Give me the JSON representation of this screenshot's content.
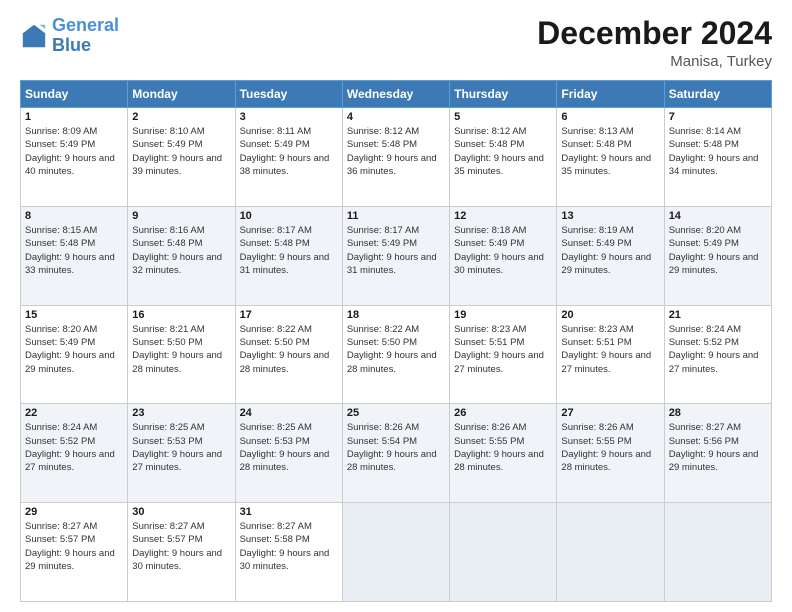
{
  "logo": {
    "line1": "General",
    "line2": "Blue"
  },
  "title": "December 2024",
  "subtitle": "Manisa, Turkey",
  "headers": [
    "Sunday",
    "Monday",
    "Tuesday",
    "Wednesday",
    "Thursday",
    "Friday",
    "Saturday"
  ],
  "weeks": [
    [
      {
        "day": "1",
        "sunrise": "8:09 AM",
        "sunset": "5:49 PM",
        "daylight": "9 hours and 40 minutes."
      },
      {
        "day": "2",
        "sunrise": "8:10 AM",
        "sunset": "5:49 PM",
        "daylight": "9 hours and 39 minutes."
      },
      {
        "day": "3",
        "sunrise": "8:11 AM",
        "sunset": "5:49 PM",
        "daylight": "9 hours and 38 minutes."
      },
      {
        "day": "4",
        "sunrise": "8:12 AM",
        "sunset": "5:48 PM",
        "daylight": "9 hours and 36 minutes."
      },
      {
        "day": "5",
        "sunrise": "8:12 AM",
        "sunset": "5:48 PM",
        "daylight": "9 hours and 35 minutes."
      },
      {
        "day": "6",
        "sunrise": "8:13 AM",
        "sunset": "5:48 PM",
        "daylight": "9 hours and 35 minutes."
      },
      {
        "day": "7",
        "sunrise": "8:14 AM",
        "sunset": "5:48 PM",
        "daylight": "9 hours and 34 minutes."
      }
    ],
    [
      {
        "day": "8",
        "sunrise": "8:15 AM",
        "sunset": "5:48 PM",
        "daylight": "9 hours and 33 minutes."
      },
      {
        "day": "9",
        "sunrise": "8:16 AM",
        "sunset": "5:48 PM",
        "daylight": "9 hours and 32 minutes."
      },
      {
        "day": "10",
        "sunrise": "8:17 AM",
        "sunset": "5:48 PM",
        "daylight": "9 hours and 31 minutes."
      },
      {
        "day": "11",
        "sunrise": "8:17 AM",
        "sunset": "5:49 PM",
        "daylight": "9 hours and 31 minutes."
      },
      {
        "day": "12",
        "sunrise": "8:18 AM",
        "sunset": "5:49 PM",
        "daylight": "9 hours and 30 minutes."
      },
      {
        "day": "13",
        "sunrise": "8:19 AM",
        "sunset": "5:49 PM",
        "daylight": "9 hours and 29 minutes."
      },
      {
        "day": "14",
        "sunrise": "8:20 AM",
        "sunset": "5:49 PM",
        "daylight": "9 hours and 29 minutes."
      }
    ],
    [
      {
        "day": "15",
        "sunrise": "8:20 AM",
        "sunset": "5:49 PM",
        "daylight": "9 hours and 29 minutes."
      },
      {
        "day": "16",
        "sunrise": "8:21 AM",
        "sunset": "5:50 PM",
        "daylight": "9 hours and 28 minutes."
      },
      {
        "day": "17",
        "sunrise": "8:22 AM",
        "sunset": "5:50 PM",
        "daylight": "9 hours and 28 minutes."
      },
      {
        "day": "18",
        "sunrise": "8:22 AM",
        "sunset": "5:50 PM",
        "daylight": "9 hours and 28 minutes."
      },
      {
        "day": "19",
        "sunrise": "8:23 AM",
        "sunset": "5:51 PM",
        "daylight": "9 hours and 27 minutes."
      },
      {
        "day": "20",
        "sunrise": "8:23 AM",
        "sunset": "5:51 PM",
        "daylight": "9 hours and 27 minutes."
      },
      {
        "day": "21",
        "sunrise": "8:24 AM",
        "sunset": "5:52 PM",
        "daylight": "9 hours and 27 minutes."
      }
    ],
    [
      {
        "day": "22",
        "sunrise": "8:24 AM",
        "sunset": "5:52 PM",
        "daylight": "9 hours and 27 minutes."
      },
      {
        "day": "23",
        "sunrise": "8:25 AM",
        "sunset": "5:53 PM",
        "daylight": "9 hours and 27 minutes."
      },
      {
        "day": "24",
        "sunrise": "8:25 AM",
        "sunset": "5:53 PM",
        "daylight": "9 hours and 28 minutes."
      },
      {
        "day": "25",
        "sunrise": "8:26 AM",
        "sunset": "5:54 PM",
        "daylight": "9 hours and 28 minutes."
      },
      {
        "day": "26",
        "sunrise": "8:26 AM",
        "sunset": "5:55 PM",
        "daylight": "9 hours and 28 minutes."
      },
      {
        "day": "27",
        "sunrise": "8:26 AM",
        "sunset": "5:55 PM",
        "daylight": "9 hours and 28 minutes."
      },
      {
        "day": "28",
        "sunrise": "8:27 AM",
        "sunset": "5:56 PM",
        "daylight": "9 hours and 29 minutes."
      }
    ],
    [
      {
        "day": "29",
        "sunrise": "8:27 AM",
        "sunset": "5:57 PM",
        "daylight": "9 hours and 29 minutes."
      },
      {
        "day": "30",
        "sunrise": "8:27 AM",
        "sunset": "5:57 PM",
        "daylight": "9 hours and 30 minutes."
      },
      {
        "day": "31",
        "sunrise": "8:27 AM",
        "sunset": "5:58 PM",
        "daylight": "9 hours and 30 minutes."
      },
      null,
      null,
      null,
      null
    ]
  ]
}
